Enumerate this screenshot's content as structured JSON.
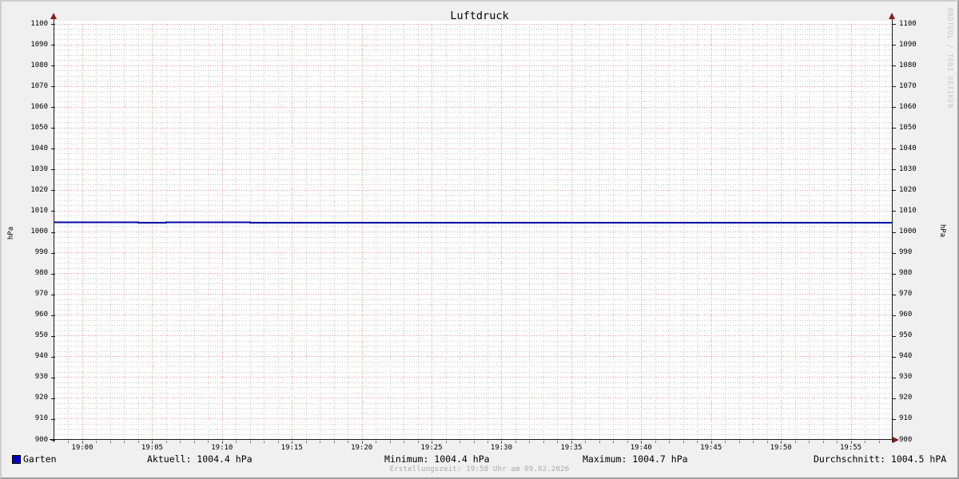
{
  "watermark": "RRDTOOL / TOBI OETIKER",
  "footer": "Erstellungszeit: 19:58 Uhr am 09.02.2026",
  "legend": {
    "series": "Garten",
    "aktuell": "Aktuell: 1004.4 hPa",
    "minimum": "Minimum: 1004.4 hPa",
    "maximum": "Maximum: 1004.7 hPa",
    "durchschnitt": "Durchschnitt: 1004.5 hPA"
  },
  "chart_data": {
    "type": "line",
    "title": "Luftdruck",
    "ylabel": "hPa",
    "xlabel": "",
    "x_range": [
      "18:58",
      "19:58"
    ],
    "x_tick_labels": [
      "19:00",
      "19:05",
      "19:10",
      "19:15",
      "19:20",
      "19:25",
      "19:30",
      "19:35",
      "19:40",
      "19:45",
      "19:50",
      "19:55"
    ],
    "x_major_step_minutes": 5,
    "x_minor_step_minutes": 1,
    "ylim": [
      900,
      1100
    ],
    "y_major_step": 10,
    "y_minor_step": 2.5,
    "grid": true,
    "legend_position": "bottom",
    "series": [
      {
        "name": "Garten",
        "color": "#0909a8",
        "points": [
          [
            "18:58",
            1004.6
          ],
          [
            "19:04",
            1004.6
          ],
          [
            "19:04",
            1004.4
          ],
          [
            "19:06",
            1004.4
          ],
          [
            "19:06",
            1004.6
          ],
          [
            "19:12",
            1004.6
          ],
          [
            "19:12",
            1004.5
          ],
          [
            "19:58",
            1004.5
          ]
        ]
      }
    ],
    "stats": {
      "aktuell_hpa": 1004.4,
      "minimum_hpa": 1004.4,
      "maximum_hpa": 1004.7,
      "durchschnitt_hpa": 1004.5
    },
    "colors": {
      "line": "#0909a8",
      "swatch": "#0000c8",
      "grid_major": "#e09999",
      "grid_minor": "#c9c9c9",
      "arrow": "#8a1c1c",
      "axis": "#1a1a1a",
      "background": "#f0f0f0",
      "plot_background": "#ffffff"
    }
  }
}
